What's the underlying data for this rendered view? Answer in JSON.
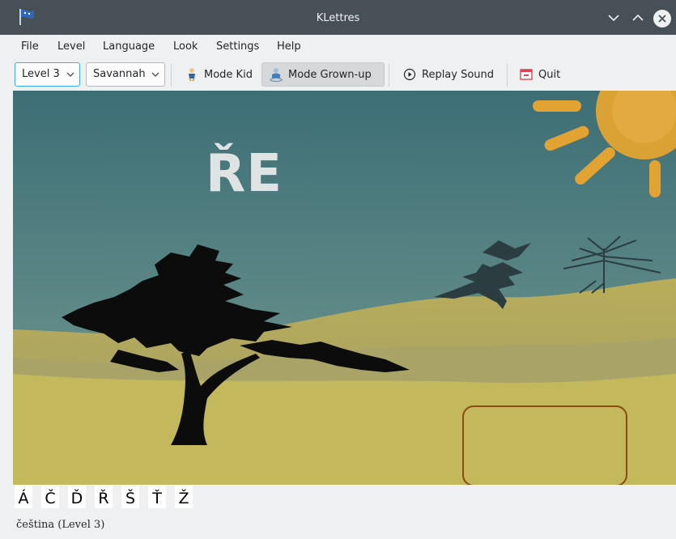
{
  "window": {
    "title": "KLettres"
  },
  "menu": [
    "File",
    "Level",
    "Language",
    "Look",
    "Settings",
    "Help"
  ],
  "toolbar": {
    "level_value": "Level 3",
    "world_value": "Savannah",
    "mode_kid_label": "Mode Kid",
    "mode_grownup_label": "Mode Grown-up",
    "replay_label": "Replay Sound",
    "quit_label": "Quit"
  },
  "game": {
    "shown_word": "ŘE",
    "answer_value": ""
  },
  "special_letters": [
    "Á",
    "Č",
    "Ď",
    "Ř",
    "Š",
    "Ť",
    "Ž"
  ],
  "status": {
    "text": "čeština  (Level 3)"
  },
  "colors": {
    "sky_top": "#3d6e76",
    "sky_bottom": "#7a9492",
    "ground": "#c3b85c",
    "sun": "#e3a332",
    "answer_border": "#8b4a12",
    "titlebar": "#475057"
  },
  "icons": {
    "app": "flag-icon",
    "minimize": "chevron-down-icon",
    "maximize": "chevron-up-icon",
    "close": "close-icon",
    "kid": "kid-icon",
    "grownup": "grownup-icon",
    "replay": "play-circle-icon",
    "quit": "quit-icon"
  }
}
